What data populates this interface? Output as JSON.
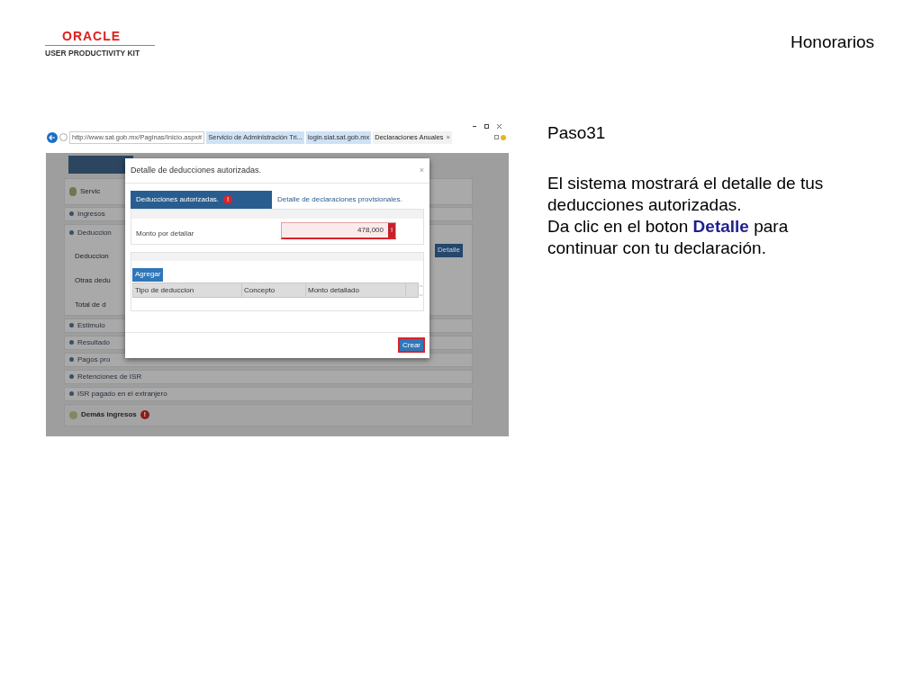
{
  "logo": {
    "brand": "ORACLE",
    "product": "USER PRODUCTIVITY KIT"
  },
  "header": "Honorarios",
  "screenshot": {
    "browser": {
      "url": "http://www.sat.gob.mx/Paginas/Inicio.aspx#",
      "tabs": [
        {
          "label": "Servicio de Administración Tri...",
          "selected": false
        },
        {
          "label": "login.siat.sat.gob.mx",
          "selected": false
        },
        {
          "label": "Declaraciones Anuales",
          "selected": true
        }
      ],
      "tab_close": "×"
    },
    "page": {
      "section": "Servic",
      "rows_top": [
        "Ingresos"
      ],
      "deducciones": {
        "title": "Deduccion",
        "items": [
          "Deduccion",
          "Otras dedu",
          "Total de d"
        ],
        "button": "Detalle"
      },
      "rows": [
        "Estimulo",
        "Resultado",
        "Pagos pro",
        "Retenciones de ISR",
        "ISR pagado en el extranjero"
      ],
      "footer_section": {
        "label": "Demás ingresos",
        "badge": "!"
      }
    },
    "dialog": {
      "title": "Detalle de deducciones autorizadas.",
      "close": "×",
      "tabs": [
        {
          "label": "Deducciones autorizadas.",
          "badge": "!",
          "selected": true
        },
        {
          "label": "Detalle de declaraciones provisionales.",
          "selected": false
        }
      ],
      "field": {
        "label": "Monto por detallar",
        "value": "478,000",
        "error": "!"
      },
      "add_button": "Agregar",
      "columns": [
        "Tipo de deduccion",
        "Concepto",
        "Monto detallado"
      ],
      "create_button": "Crear"
    }
  },
  "step": "Paso31",
  "paragraphs": [
    "El sistema mostrará el detalle de tus deducciones autorizadas.",
    "Da clic en el boton **Detalle** para continuar con tu declaración."
  ]
}
